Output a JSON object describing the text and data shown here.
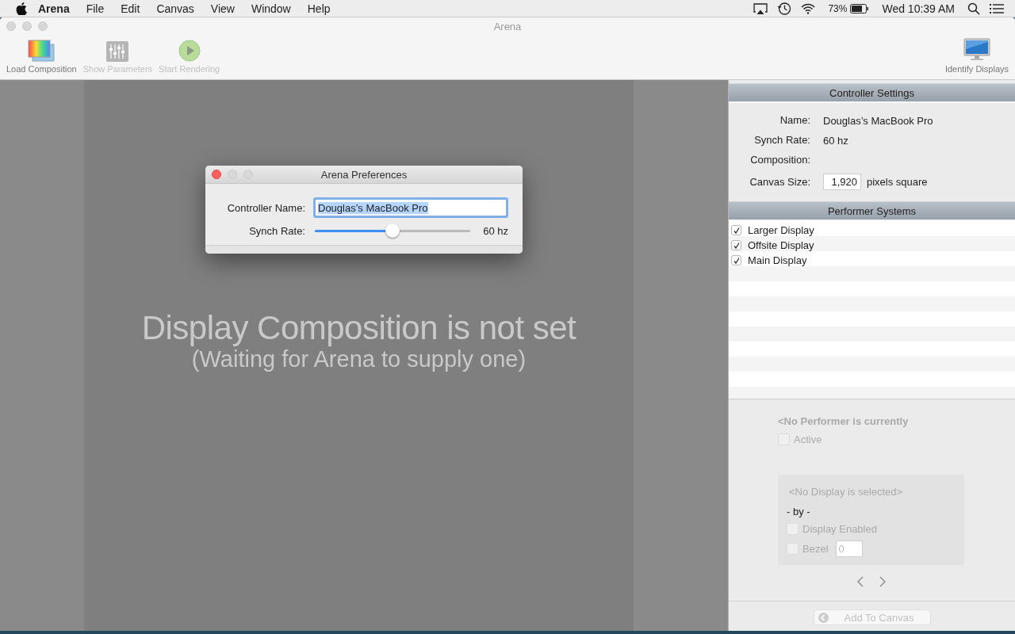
{
  "menu_bar": {
    "menus": [
      "Arena",
      "File",
      "Edit",
      "Canvas",
      "View",
      "Window",
      "Help"
    ],
    "battery": "73%",
    "clock": "Wed 10:39 AM"
  },
  "window": {
    "title": "Arena"
  },
  "toolbar": {
    "left": [
      {
        "label": "Load Composition",
        "kind": "composition",
        "disabled": false
      },
      {
        "label": "Show Parameters",
        "kind": "sliders",
        "disabled": true
      },
      {
        "label": "Start Rendering",
        "kind": "play",
        "disabled": true
      }
    ],
    "right": [
      {
        "label": "Identify Displays",
        "kind": "monitor",
        "disabled": false
      }
    ]
  },
  "canvas": {
    "message": "Display Composition is not set",
    "submessage": "(Waiting for Arena to supply one)"
  },
  "preferences_dialog": {
    "title": "Arena Preferences",
    "name_label": "Controller Name:",
    "name_value": "Douglas’s MacBook Pro",
    "name_text_selected": true,
    "rate_label": "Synch Rate:",
    "rate": {
      "level": 0.5,
      "reading": "60 hz"
    }
  },
  "controller_settings": {
    "title": "Controller Settings",
    "rows": [
      {
        "label": "Name:",
        "value": "Douglas’s MacBook Pro",
        "kind": "text"
      },
      {
        "label": "Synch Rate:",
        "value": "60 hz",
        "kind": "text"
      },
      {
        "label": "Composition:",
        "kind": "text"
      },
      {
        "label": "Canvas Size:",
        "value": "1,920",
        "unit": "pixels square",
        "kind": "field"
      }
    ]
  },
  "performer_systems": {
    "title": "Performer Systems",
    "items": [
      {
        "name": "Larger Display",
        "checked": true
      },
      {
        "name": "Offsite Display",
        "checked": true
      },
      {
        "name": "Main Display",
        "checked": true
      }
    ]
  },
  "performer_details": {
    "title": "<No Performer is currently",
    "active": {
      "label": "Active",
      "checked": false
    },
    "display_box": {
      "title": "<No Display is selected>",
      "by": "- by -",
      "display_enabled": {
        "label": "Display Enabled",
        "checked": false
      },
      "bezel": {
        "label": "Bezel",
        "checked": false,
        "placeholder": "0"
      }
    }
  },
  "add_button": {
    "label": "Add To Canvas",
    "disabled": true
  }
}
